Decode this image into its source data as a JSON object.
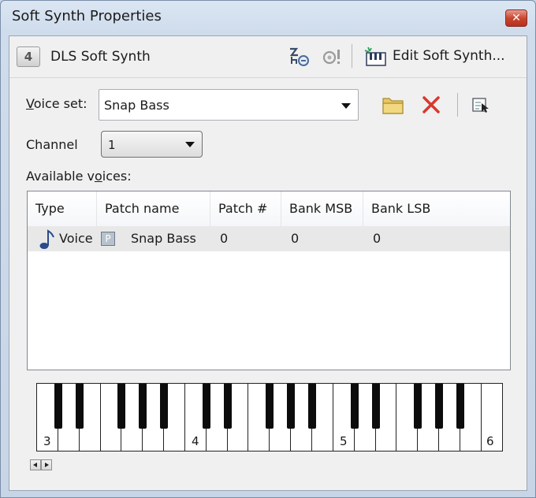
{
  "window": {
    "title": "Soft Synth Properties",
    "close_glyph": "✕"
  },
  "toolbar": {
    "synth_icon": "synth-module-icon",
    "synth_icon_text": "4",
    "synth_name": "DLS Soft Synth",
    "edit_label": "Edit Soft Synth..."
  },
  "voice_set": {
    "label_prefix": "V",
    "label_rest": "oice set:",
    "value": "Snap Bass"
  },
  "channel": {
    "label": "Channel",
    "value": "1"
  },
  "available_voices": {
    "label_before": "Available v",
    "label_u": "o",
    "label_after": "ices:"
  },
  "voices_table": {
    "columns": [
      "Type",
      "Patch name",
      "Patch #",
      "Bank MSB",
      "Bank LSB"
    ],
    "rows": [
      {
        "type": "Voice",
        "patch_name": "Snap Bass",
        "patch_number": "0",
        "bank_msb": "0",
        "bank_lsb": "0",
        "patch_icon": "P"
      }
    ]
  },
  "keyboard": {
    "octave_labels": [
      "3",
      "4",
      "5",
      "6"
    ]
  },
  "colors": {
    "delete_red": "#d8382c",
    "folder_yellow": "#e8c860",
    "close_red": "#c9472f"
  }
}
